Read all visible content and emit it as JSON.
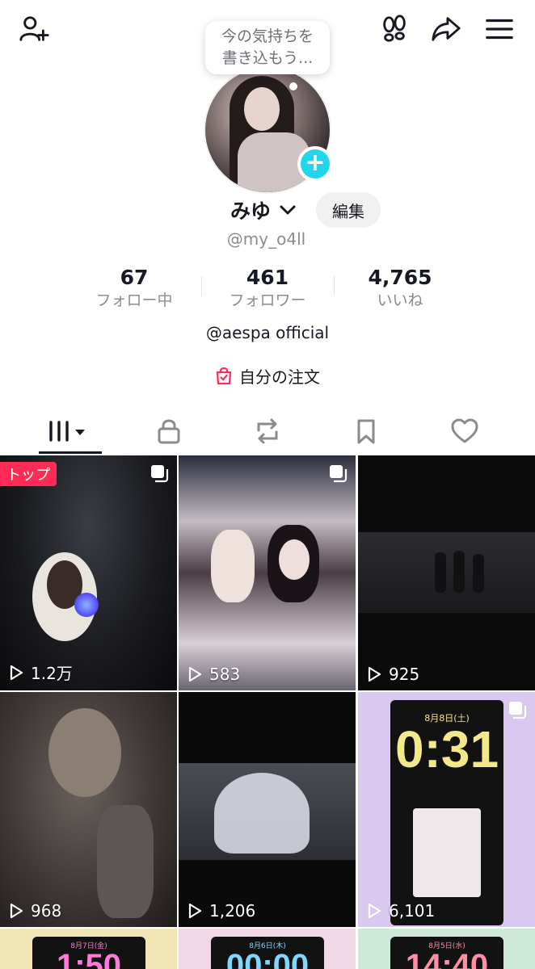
{
  "header": {
    "add_friend_icon": "person-plus-icon",
    "footprints_icon": "footprints-icon",
    "share_icon": "share-arrow-icon",
    "menu_icon": "hamburger-menu-icon"
  },
  "status_bubble": {
    "line1": "今の気持ちを",
    "line2": "書き込もう..."
  },
  "profile": {
    "name": "みゆ",
    "edit_label": "編集",
    "handle": "@my_o4ll",
    "bio": "@aespa official",
    "orders_label": "自分の注文"
  },
  "stats": [
    {
      "value": "67",
      "label": "フォロー中"
    },
    {
      "value": "461",
      "label": "フォロワー"
    },
    {
      "value": "4,765",
      "label": "いいね"
    }
  ],
  "tabs": [
    {
      "icon": "grid-bars-icon",
      "active": true
    },
    {
      "icon": "lock-icon",
      "active": false
    },
    {
      "icon": "repost-icon",
      "active": false
    },
    {
      "icon": "bookmark-icon",
      "active": false
    },
    {
      "icon": "heart-icon",
      "active": false
    }
  ],
  "videos": [
    {
      "views": "1.2万",
      "badge": "トップ",
      "multi": true
    },
    {
      "views": "583",
      "multi": true
    },
    {
      "views": "925",
      "multi": false
    },
    {
      "views": "968",
      "multi": false
    },
    {
      "views": "1,206",
      "multi": false
    },
    {
      "views": "6,101",
      "multi": true,
      "clock": "0:31",
      "date": "8月8日(土)"
    },
    {
      "clock": "1:50",
      "date": "8月7日(金)"
    },
    {
      "clock": "00:00",
      "date": "8月6日(木)"
    },
    {
      "clock": "14:40",
      "date": "8月5日(水)"
    }
  ],
  "colors": {
    "accent_red": "#fe2c55",
    "add_badge": "#20d5ec",
    "text_primary": "#161823",
    "text_secondary": "#8a8b91"
  }
}
